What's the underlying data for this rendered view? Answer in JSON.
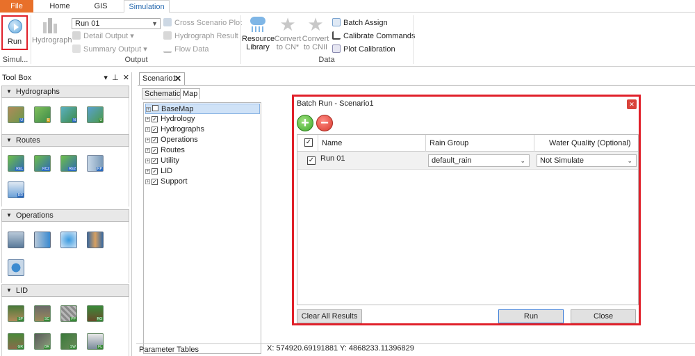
{
  "ribbon": {
    "tabs": [
      "File",
      "Home",
      "GIS",
      "Simulation"
    ],
    "run_label": "Run",
    "hydrograph_label": "Hydrograph",
    "run_select_value": "Run 01",
    "detail_output": "Detail Output",
    "summary_output": "Summary Output",
    "cross_scenario_plot": "Cross Scenario Plot",
    "hydrograph_result": "Hydrograph Result",
    "flow_data": "Flow Data",
    "resource_library": "Resource\nLibrary",
    "convert_cn": "Convert\nto CN*",
    "convert_cnii": "Convert\nto CNII",
    "batch_assign": "Batch Assign",
    "calibrate_commands": "Calibrate Commands",
    "plot_calibration": "Plot Calibration",
    "group_simul": "Simul...",
    "group_output": "Output",
    "group_data": "Data"
  },
  "toolbox": {
    "title": "Tool Box",
    "sections": [
      "Hydrographs",
      "Routes",
      "Operations",
      "LID"
    ],
    "hydrograph_tags": [
      "U",
      "S",
      "N",
      "U"
    ],
    "route_tags": [
      "REL",
      "RC2",
      "RE2",
      "RP",
      "RR"
    ],
    "lid_tags": [
      "SP",
      "SC",
      "PP",
      "RG",
      "GR",
      "BR",
      "SW",
      "FL"
    ]
  },
  "document": {
    "tab_label": "Scenario1",
    "subtabs": [
      "Schematic",
      "Map"
    ],
    "tree": [
      {
        "label": "BaseMap",
        "checked": false
      },
      {
        "label": "Hydrology",
        "checked": true
      },
      {
        "label": "Hydrographs",
        "checked": true
      },
      {
        "label": "Operations",
        "checked": true
      },
      {
        "label": "Routes",
        "checked": true
      },
      {
        "label": "Utility",
        "checked": true
      },
      {
        "label": "LID",
        "checked": true
      },
      {
        "label": "Support",
        "checked": true
      }
    ],
    "coordinates": "X:  574920.69191881  Y:  4868233.11396829",
    "parameter_tables": "Parameter Tables"
  },
  "dialog": {
    "title": "Batch Run - Scenario1",
    "columns": [
      "Name",
      "Rain Group",
      "Water Quality (Optional)"
    ],
    "rows": [
      {
        "name": "Run 01",
        "rain_group": "default_rain",
        "water_quality": "Not Simulate",
        "checked": true
      }
    ],
    "clear_all": "Clear All Results",
    "run": "Run",
    "close": "Close"
  },
  "colors": {
    "accent_red": "#e0202a",
    "file_tab": "#e8702a",
    "selection_blue": "#cfe2f7"
  }
}
